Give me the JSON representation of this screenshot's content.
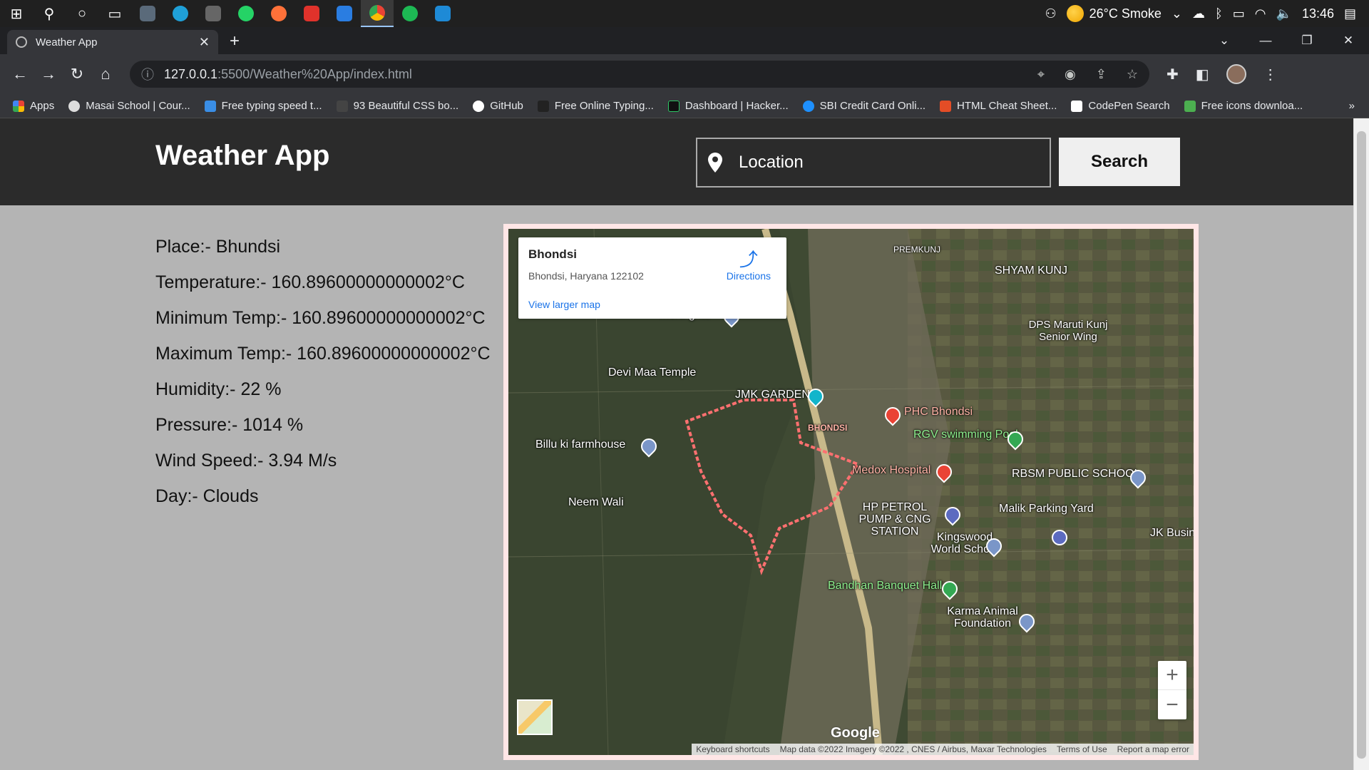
{
  "taskbar": {
    "weather_text": "26°C Smoke",
    "time": "13:46"
  },
  "browser": {
    "tab_title": "Weather App",
    "url_host": "127.0.0.1",
    "url_path": ":5500/Weather%20App/index.html",
    "bookmarks": [
      "Apps",
      "Masai School | Cour...",
      "Free typing speed t...",
      "93 Beautiful CSS bo...",
      "GitHub",
      "Free Online Typing...",
      "Dashboard | Hacker...",
      "SBI Credit Card Onli...",
      "HTML Cheat Sheet...",
      "CodePen Search",
      "Free icons downloa..."
    ],
    "bookmarks_more": "»"
  },
  "app": {
    "title": "Weather App",
    "search_placeholder": "Location",
    "search_button": "Search"
  },
  "weather": {
    "place": "Place:- Bhundsi",
    "temperature": "Temperature:- 160.89600000000002°C",
    "min_temp": "Minimum Temp:- 160.89600000000002°C",
    "max_temp": "Maximum Temp:- 160.89600000000002°C",
    "humidity": "Humidity:- 22 %",
    "pressure": "Pressure:- 1014 %",
    "wind": "Wind Speed:- 3.94 M/s",
    "day": "Day:- Clouds"
  },
  "map": {
    "card_name": "Bhondsi",
    "card_address": "Bhondsi, Haryana 122102",
    "card_link": "View larger map",
    "directions": "Directions",
    "labels": [
      "Mera ghar",
      "Devi Maa Temple",
      "JMK GARDEN",
      "PHC Bhondsi",
      "RGV swimming Pool",
      "Billu ki farmhouse",
      "BHONDSI",
      "Medox Hospital",
      "RBSM PUBLIC SCHOOL",
      "Neem Wali",
      "HP PETROL PUMP & CNG STATION",
      "Malik Parking Yard",
      "Kingswood World School",
      "JK Busin",
      "Bandhan Banquet Hall",
      "Karma Animal Foundation",
      "PREMKUNJ",
      "SHYAM KUNJ",
      "DPS Maruti Kunj Senior Wing"
    ],
    "zoom_in": "+",
    "zoom_out": "−",
    "google": "Google",
    "attribution": [
      "Keyboard shortcuts",
      "Map data ©2022 Imagery ©2022 , CNES / Airbus, Maxar Technologies",
      "Terms of Use",
      "Report a map error"
    ]
  }
}
